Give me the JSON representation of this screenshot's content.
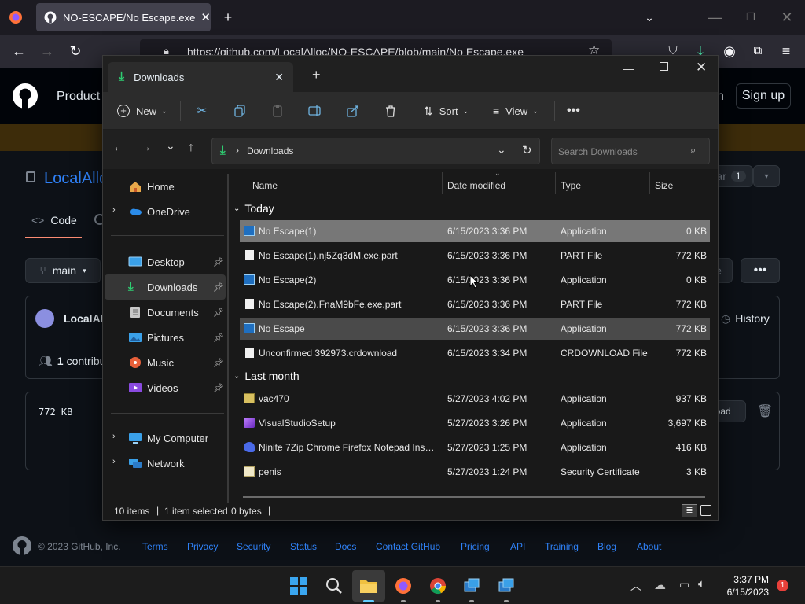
{
  "browser": {
    "tab_title": "NO-ESCAPE/No Escape.exe at",
    "url": "https://github.com/LocalAlloc/NO-ESCAPE/blob/main/No Escape.exe"
  },
  "github": {
    "product_label": "Product",
    "sign_in_partial": "n",
    "sign_up": "Sign up",
    "repo_owner_partial": "LocalAllo",
    "star_partial": "ar",
    "star_count": "1",
    "code_tab": "Code",
    "branch": "main",
    "commit_author_partial": "LocalAll",
    "history": "History",
    "contributors_count": "1",
    "contributors_partial": "contribu",
    "file_size": "772 KB",
    "download_partial": "nload",
    "partial_e": "e",
    "footer": {
      "copyright": "© 2023 GitHub, Inc.",
      "links": [
        "Terms",
        "Privacy",
        "Security",
        "Status",
        "Docs",
        "Contact GitHub",
        "Pricing",
        "API",
        "Training",
        "Blog",
        "About"
      ]
    }
  },
  "explorer": {
    "tab_title": "Downloads",
    "toolbar": {
      "new": "New",
      "sort": "Sort",
      "view": "View"
    },
    "breadcrumb": "Downloads",
    "search_placeholder": "Search Downloads",
    "nav": {
      "home": "Home",
      "onedrive": "OneDrive",
      "desktop": "Desktop",
      "downloads": "Downloads",
      "documents": "Documents",
      "pictures": "Pictures",
      "music": "Music",
      "videos": "Videos",
      "my_computer": "My Computer",
      "network": "Network"
    },
    "columns": {
      "name": "Name",
      "date": "Date modified",
      "type": "Type",
      "size": "Size"
    },
    "groups": {
      "today": "Today",
      "last_month": "Last month"
    },
    "files": [
      {
        "name": "No Escape(1)",
        "date": "6/15/2023 3:36 PM",
        "type": "Application",
        "size": "0 KB",
        "icon": "app-icon"
      },
      {
        "name": "No Escape(1).nj5Zq3dM.exe.part",
        "date": "6/15/2023 3:36 PM",
        "type": "PART File",
        "size": "772 KB",
        "icon": "file-icon"
      },
      {
        "name": "No Escape(2)",
        "date": "6/15/2023 3:36 PM",
        "type": "Application",
        "size": "0 KB",
        "icon": "app-icon"
      },
      {
        "name": "No Escape(2).FnaM9bFe.exe.part",
        "date": "6/15/2023 3:36 PM",
        "type": "PART File",
        "size": "772 KB",
        "icon": "file-icon"
      },
      {
        "name": "No Escape",
        "date": "6/15/2023 3:36 PM",
        "type": "Application",
        "size": "772 KB",
        "icon": "app-icon"
      },
      {
        "name": "Unconfirmed 392973.crdownload",
        "date": "6/15/2023 3:34 PM",
        "type": "CRDOWNLOAD File",
        "size": "772 KB",
        "icon": "file-icon"
      },
      {
        "name": "vac470",
        "date": "5/27/2023 4:02 PM",
        "type": "Application",
        "size": "937 KB",
        "icon": "installer-icon"
      },
      {
        "name": "VisualStudioSetup",
        "date": "5/27/2023 3:26 PM",
        "type": "Application",
        "size": "3,697 KB",
        "icon": "visual-studio-icon"
      },
      {
        "name": "Ninite 7Zip Chrome Firefox Notepad Inst...",
        "date": "5/27/2023 1:25 PM",
        "type": "Application",
        "size": "416 KB",
        "icon": "ninite-icon"
      },
      {
        "name": "penis",
        "date": "5/27/2023 1:24 PM",
        "type": "Security Certificate",
        "size": "3 KB",
        "icon": "certificate-icon"
      }
    ],
    "status": {
      "items": "10 items",
      "selected": "1 item selected",
      "bytes": "0 bytes"
    }
  },
  "taskbar": {
    "time": "3:37 PM",
    "date": "6/15/2023",
    "notification_count": "1"
  }
}
